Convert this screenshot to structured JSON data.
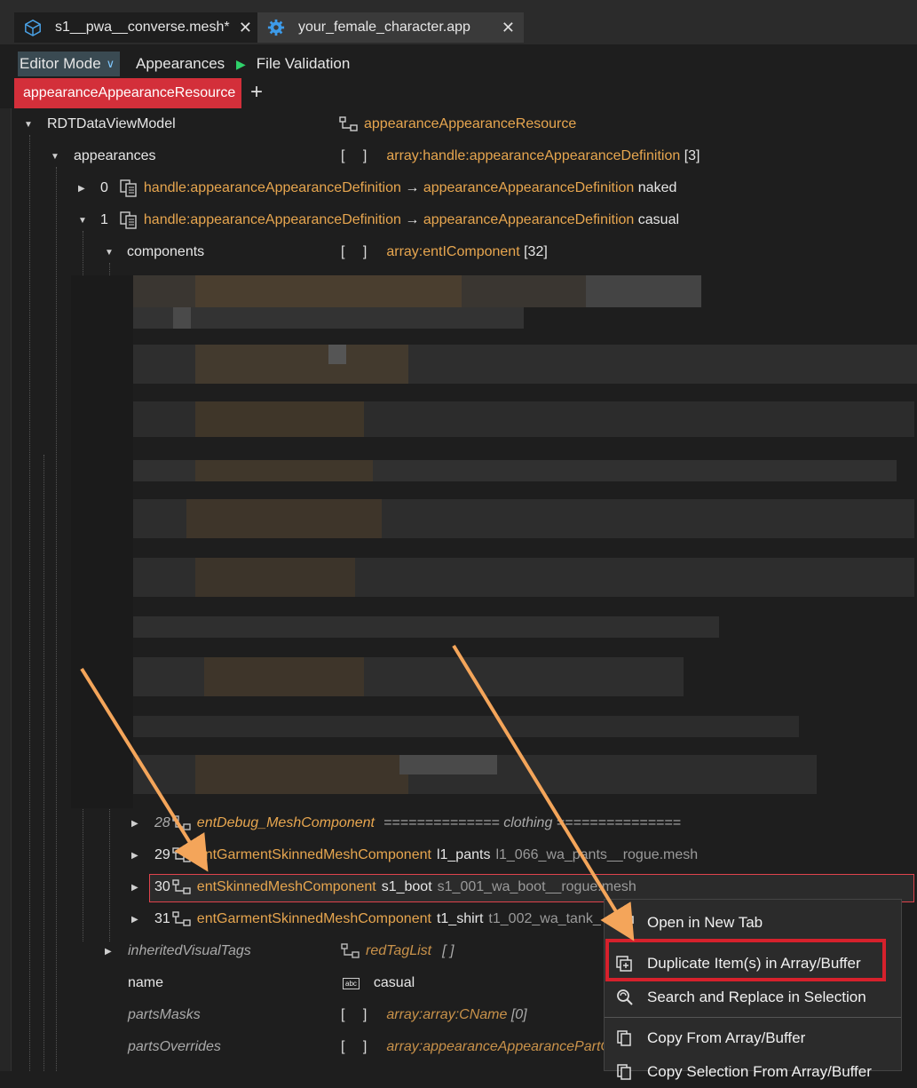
{
  "tabs": [
    {
      "label": "s1__pwa__converse.mesh*",
      "icon": "cube-icon"
    },
    {
      "label": "your_female_character.app",
      "icon": "gear-icon"
    }
  ],
  "toolbar": {
    "editor_mode": "Editor Mode",
    "appearances": "Appearances",
    "file_validation": "File Validation"
  },
  "resource_tab": "appearanceAppearanceResource",
  "tree": {
    "root": {
      "name": "RDTDataViewModel",
      "type": "appearanceAppearanceResource"
    },
    "appearances": {
      "name": "appearances",
      "type": "array:handle:appearanceAppearanceDefinition",
      "count": "[3]"
    },
    "app0": {
      "index": "0",
      "handle": "handle:appearanceAppearanceDefinition",
      "arrow": "→",
      "target": "appearanceAppearanceDefinition",
      "value": "naked"
    },
    "app1": {
      "index": "1",
      "handle": "handle:appearanceAppearanceDefinition",
      "arrow": "→",
      "target": "appearanceAppearanceDefinition",
      "value": "casual"
    },
    "components": {
      "name": "components",
      "type": "array:entIComponent",
      "count": "[32]"
    },
    "c28": {
      "index": "28",
      "type": "entDebug_MeshComponent",
      "value": "============== clothing ==============="
    },
    "c29": {
      "index": "29",
      "type": "entGarmentSkinnedMeshComponent",
      "name": "l1_pants",
      "file": "l1_066_wa_pants__rogue.mesh"
    },
    "c30": {
      "index": "30",
      "type": "entSkinnedMeshComponent",
      "name": "s1_boot",
      "file": "s1_001_wa_boot__rogue.mesh"
    },
    "c31": {
      "index": "31",
      "type": "entGarmentSkinnedMeshComponent",
      "name": "t1_shirt",
      "file": "t1_002_wa_tank_"
    },
    "inherited": {
      "name": "inheritedVisualTags",
      "type": "redTagList",
      "value": "[ ]"
    },
    "name": {
      "name": "name",
      "value": "casual"
    },
    "partsMasks": {
      "name": "partsMasks",
      "type": "array:array:CName",
      "count": "[0]"
    },
    "partsOverrides": {
      "name": "partsOverrides",
      "type": "array:appearanceAppearancePartOve"
    }
  },
  "context_menu": [
    {
      "label": "Open in New Tab",
      "icon": "new-tab-icon"
    },
    {
      "label": "Duplicate Item(s) in Array/Buffer",
      "icon": "duplicate-icon"
    },
    {
      "label": "Search and Replace in Selection",
      "icon": "search-replace-icon"
    },
    {
      "label": "Copy From Array/Buffer",
      "icon": "copy-icon"
    },
    {
      "label": "Copy Selection From Array/Buffer",
      "icon": "copy-selection-icon"
    }
  ],
  "colors": {
    "accent_red": "#d32f3a",
    "orange": "#e7a64f",
    "arrow_annotation": "#f4a55a",
    "highlight_box": "#d6212c"
  }
}
